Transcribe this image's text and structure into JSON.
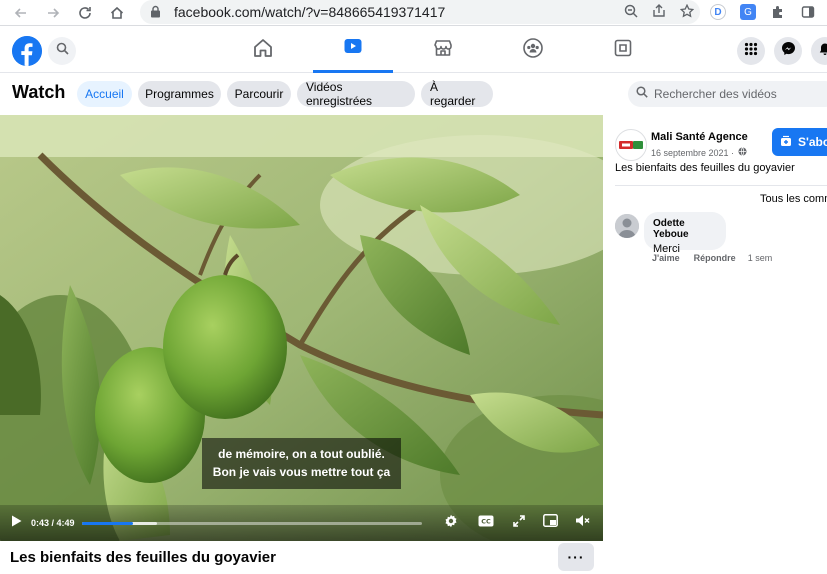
{
  "browser": {
    "url": "facebook.com/watch/?v=848665419371417"
  },
  "subnav": {
    "title": "Watch",
    "tabs": [
      {
        "label": "Accueil",
        "active": true
      },
      {
        "label": "Programmes",
        "active": false
      },
      {
        "label": "Parcourir",
        "active": false
      },
      {
        "label": "Vidéos enregistrées",
        "active": false
      },
      {
        "label": "À regarder",
        "active": false
      }
    ],
    "search_placeholder": "Rechercher des vidéos"
  },
  "video": {
    "subtitle_line1": "de mémoire, on a tout oublié.",
    "subtitle_line2": "Bon je vais vous mettre tout ça",
    "time_display": "0:43 / 4:49",
    "played_fraction": 0.149,
    "title": "Les bienfaits des feuilles du goyavier",
    "more_label": "···"
  },
  "panel": {
    "page_name": "Mali Santé Agence",
    "post_date": "16 septembre 2021 ·",
    "subscribe_label": "S'abo",
    "post_text": "Les bienfaits des feuilles du goyavier",
    "sort_label": "Tous les comm",
    "comment": {
      "author": "Odette Yeboue",
      "text": "Merci",
      "like_label": "J'aime",
      "reply_label": "Répondre",
      "age": "1 sem"
    }
  },
  "colors": {
    "accent": "#1877f2",
    "pill_bg": "#e4e6eb",
    "pill_active_bg": "#e7f3ff"
  }
}
